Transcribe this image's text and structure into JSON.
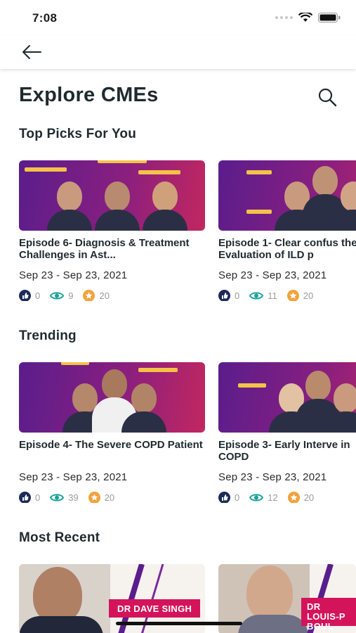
{
  "status": {
    "time": "7:08"
  },
  "header": {
    "title": "Explore CMEs"
  },
  "sections": {
    "top_picks": {
      "title": "Top Picks For You",
      "cards": [
        {
          "title": "Episode 6- Diagnosis & Treatment Challenges in Ast...",
          "date": "Sep 23 - Sep 23, 2021",
          "likes": "0",
          "views": "9",
          "points": "20"
        },
        {
          "title": "Episode 1- Clear confus the Evaluation of ILD p",
          "date": "Sep 23 - Sep 23, 2021",
          "likes": "0",
          "views": "11",
          "points": "20"
        }
      ]
    },
    "trending": {
      "title": "Trending",
      "cards": [
        {
          "title": "Episode 4- The Severe COPD Patient",
          "date": "Sep 23 - Sep 23, 2021",
          "likes": "0",
          "views": "39",
          "points": "20"
        },
        {
          "title": "Episode 3- Early Interve in COPD",
          "date": "Sep 23 - Sep 23, 2021",
          "likes": "0",
          "views": "12",
          "points": "20"
        }
      ]
    },
    "most_recent": {
      "title": "Most Recent",
      "cards": [
        {
          "speaker": "DR DAVE SINGH"
        },
        {
          "speaker": "DR LOUIS-P BOUL"
        }
      ]
    }
  },
  "icons": {
    "back": "arrow-left-icon",
    "search": "search-icon",
    "like": "thumbs-up-icon",
    "view": "eye-icon",
    "points": "star-icon"
  },
  "colors": {
    "like": "#1b2a57",
    "view": "#1aa39a",
    "points": "#f2a23a",
    "accent": "#d4145a"
  }
}
